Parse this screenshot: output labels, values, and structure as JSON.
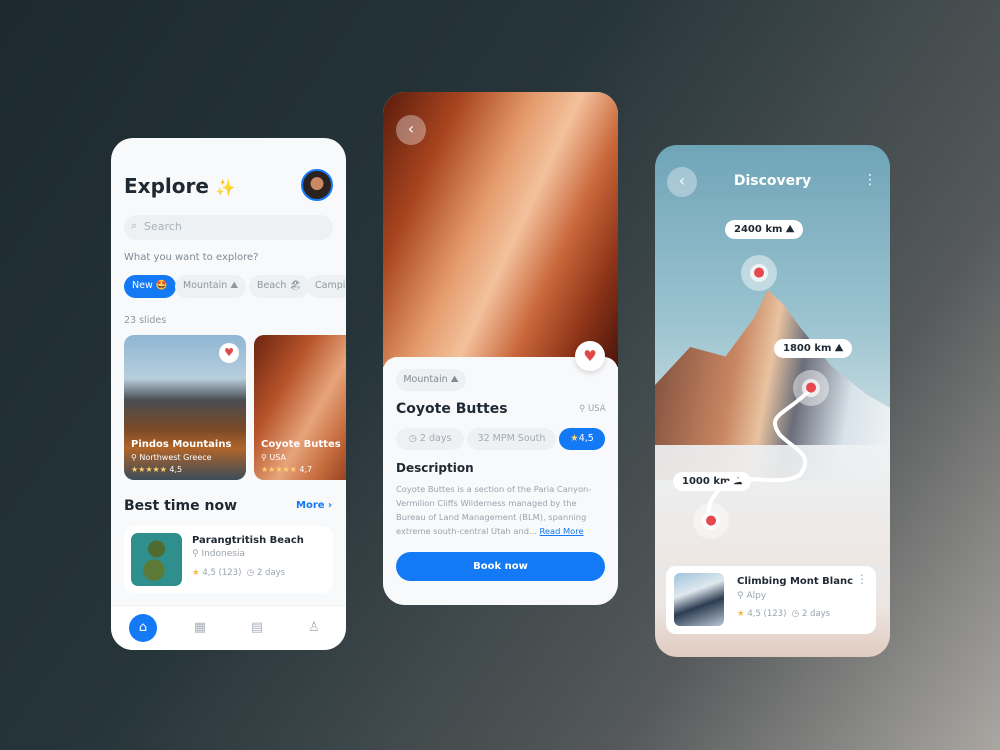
{
  "explore": {
    "title": "Explore",
    "title_emoji": "✨",
    "search_placeholder": "Search",
    "prompt": "What you want to explore?",
    "chips": [
      {
        "label": "New 🤩",
        "active": true
      },
      {
        "label": "Mountain ⛰",
        "active": false
      },
      {
        "label": "Beach 🏖",
        "active": false
      },
      {
        "label": "Campi",
        "active": false
      }
    ],
    "count": "23 slides",
    "cards": [
      {
        "name": "Pindos Mountains",
        "location": "Northwest Greece",
        "stars": "★★★★★",
        "rating": "4,5"
      },
      {
        "name": "Coyote Buttes",
        "location": "USA",
        "stars": "★★★★★",
        "rating": "4,7"
      }
    ],
    "section": "Best time now",
    "more": "More",
    "best": {
      "name": "Parangtritish Beach",
      "location": "Indonesia",
      "rating": "4,5 (123)",
      "duration": "2 days"
    },
    "nav": [
      "home-icon",
      "calendar-icon",
      "document-icon",
      "user-icon"
    ]
  },
  "detail": {
    "category": "Mountain ⛰",
    "title": "Coyote Buttes",
    "location": "USA",
    "duration": "2 days",
    "distance": "32 MPM South",
    "rating": "4,5",
    "desc_title": "Description",
    "description": "Coyote Buttes is a section of the Paria Canyon-Vermilion Cliffs Wilderness managed by the Bureau of Land Management (BLM), spanning extreme south-central Utah and...",
    "read_more": "Read More",
    "book": "Book now"
  },
  "discovery": {
    "title": "Discovery",
    "markers": [
      "2400 km ⛰",
      "1800 km ⛰",
      "1000 km ⛰"
    ],
    "card": {
      "name": "Climbing Mont Blanc",
      "location": "Alpy",
      "rating": "4,5 (123)",
      "duration": "2 days"
    }
  },
  "colors": {
    "accent": "#1479f5",
    "heart": "#e04848"
  }
}
